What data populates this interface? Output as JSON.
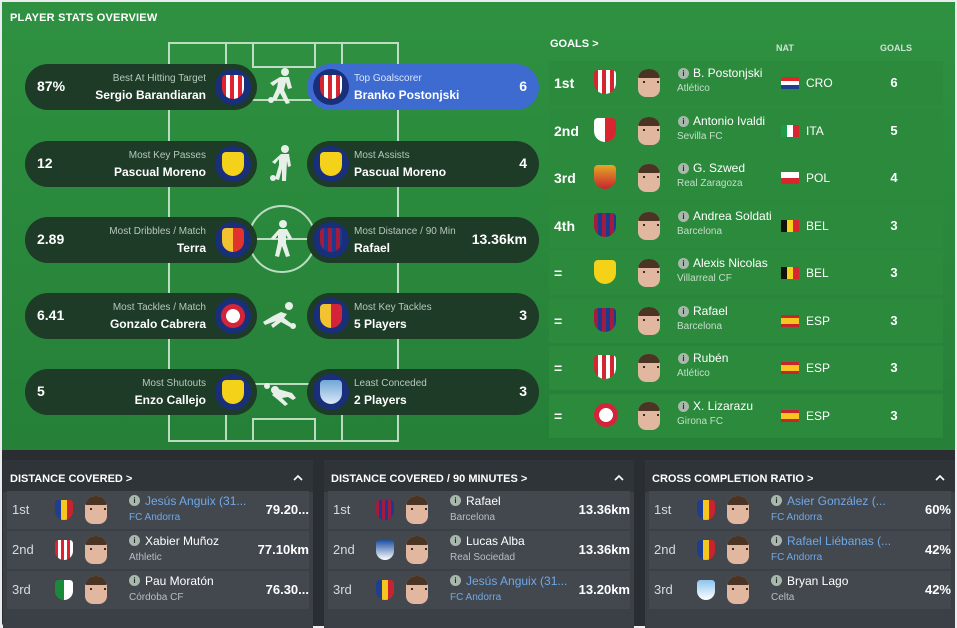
{
  "title": "PLAYER STATS OVERVIEW",
  "awards_left": [
    {
      "value": "87%",
      "caption": "Best At Hitting Target",
      "name": "Sergio Barandiaran",
      "crest": "athletic-crest-icon"
    },
    {
      "value": "12",
      "caption": "Most Key Passes",
      "name": "Pascual Moreno",
      "crest": "villarreal-crest-icon"
    },
    {
      "value": "2.89",
      "caption": "Most Dribbles / Match",
      "name": "Terra",
      "crest": "valencia-crest-icon"
    },
    {
      "value": "6.41",
      "caption": "Most Tackles / Match",
      "name": "Gonzalo Cabrera",
      "crest": "girona-crest-icon"
    },
    {
      "value": "5",
      "caption": "Most Shutouts",
      "name": "Enzo Callejo",
      "crest": "villarreal-crest-icon"
    }
  ],
  "awards_right": [
    {
      "value": "6",
      "caption": "Top Goalscorer",
      "name": "Branko Postonjski",
      "crest": "atletico-crest-icon"
    },
    {
      "value": "4",
      "caption": "Most Assists",
      "name": "Pascual Moreno",
      "crest": "villarreal-crest-icon"
    },
    {
      "value": "13.36km",
      "caption": "Most Distance / 90 Min",
      "name": "Rafael",
      "crest": "barcelona-crest-icon"
    },
    {
      "value": "3",
      "caption": "Most Key Tackles",
      "name": "5 Players",
      "crest": "multi-crest-icon"
    },
    {
      "value": "3",
      "caption": "Least Conceded",
      "name": "2 Players",
      "crest": "malaga-crest-icon"
    }
  ],
  "goals": {
    "title": "GOALS >",
    "col_nat": "NAT",
    "col_goals": "GOALS",
    "rows": [
      {
        "pos": "1st",
        "name": "B. Postonjski",
        "club": "Atlético",
        "nat": "CRO",
        "goals": "6",
        "crest": "atletico-crest-icon",
        "flag": "croatia-flag-icon"
      },
      {
        "pos": "2nd",
        "name": "Antonio Ivaldi",
        "club": "Sevilla FC",
        "nat": "ITA",
        "goals": "5",
        "crest": "sevilla-crest-icon",
        "flag": "italy-flag-icon"
      },
      {
        "pos": "3rd",
        "name": "G. Szwed",
        "club": "Real Zaragoza",
        "nat": "POL",
        "goals": "4",
        "crest": "zaragoza-crest-icon",
        "flag": "poland-flag-icon"
      },
      {
        "pos": "4th",
        "name": "Andrea Soldati",
        "club": "Barcelona",
        "nat": "BEL",
        "goals": "3",
        "crest": "barcelona-crest-icon",
        "flag": "belgium-flag-icon"
      },
      {
        "pos": "=",
        "name": "Alexis Nicolas",
        "club": "Villarreal CF",
        "nat": "BEL",
        "goals": "3",
        "crest": "villarreal-crest-icon",
        "flag": "belgium-flag-icon"
      },
      {
        "pos": "=",
        "name": "Rafael",
        "club": "Barcelona",
        "nat": "ESP",
        "goals": "3",
        "crest": "barcelona-crest-icon",
        "flag": "spain-flag-icon"
      },
      {
        "pos": "=",
        "name": "Rubén",
        "club": "Atlético",
        "nat": "ESP",
        "goals": "3",
        "crest": "atletico-crest-icon",
        "flag": "spain-flag-icon"
      },
      {
        "pos": "=",
        "name": "X. Lizarazu",
        "club": "Girona FC",
        "nat": "ESP",
        "goals": "3",
        "crest": "girona-crest-icon",
        "flag": "spain-flag-icon"
      }
    ]
  },
  "panels": [
    {
      "title": "DISTANCE COVERED >",
      "rows": [
        {
          "pos": "1st",
          "name": "Jesús Anguix (31...",
          "club": "FC Andorra",
          "value": "79.20...",
          "link": true,
          "crest": "andorra-crest-icon"
        },
        {
          "pos": "2nd",
          "name": "Xabier Muñoz",
          "club": "Athletic",
          "value": "77.10km",
          "link": false,
          "crest": "athletic-crest-icon"
        },
        {
          "pos": "3rd",
          "name": "Pau Moratón",
          "club": "Córdoba CF",
          "value": "76.30...",
          "link": false,
          "crest": "cordoba-crest-icon"
        }
      ]
    },
    {
      "title": "DISTANCE COVERED / 90 MINUTES >",
      "rows": [
        {
          "pos": "1st",
          "name": "Rafael",
          "club": "Barcelona",
          "value": "13.36km",
          "link": false,
          "crest": "barcelona-crest-icon"
        },
        {
          "pos": "2nd",
          "name": "Lucas Alba",
          "club": "Real Sociedad",
          "value": "13.36km",
          "link": false,
          "crest": "real-sociedad-crest-icon"
        },
        {
          "pos": "3rd",
          "name": "Jesús Anguix (31...",
          "club": "FC Andorra",
          "value": "13.20km",
          "link": true,
          "crest": "andorra-crest-icon"
        }
      ]
    },
    {
      "title": "CROSS COMPLETION RATIO >",
      "rows": [
        {
          "pos": "1st",
          "name": "Asier González (...",
          "club": "FC Andorra",
          "value": "60%",
          "link": true,
          "crest": "andorra-crest-icon"
        },
        {
          "pos": "2nd",
          "name": "Rafael Liébanas (...",
          "club": "FC Andorra",
          "value": "42%",
          "link": true,
          "crest": "andorra-crest-icon"
        },
        {
          "pos": "3rd",
          "name": "Bryan Lago",
          "club": "Celta",
          "value": "42%",
          "link": false,
          "crest": "celta-crest-icon"
        }
      ]
    }
  ],
  "colors": {
    "pitch_green": "#2e9140",
    "row_green": "#2c8a3c",
    "award_dark": "#1d3b26",
    "highlight_blue": "#3d6bd0",
    "panel_bg": "#3b4046",
    "link_blue": "#6fa8e8"
  }
}
